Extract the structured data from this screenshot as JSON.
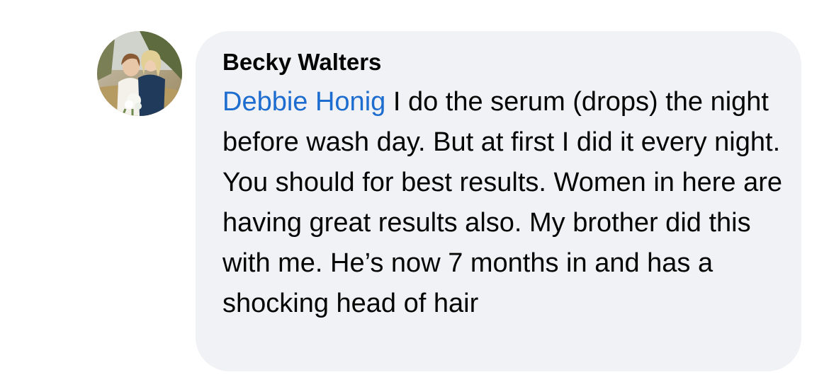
{
  "comment": {
    "avatar": "profile-photo",
    "author": "Becky Walters",
    "mention": "Debbie Honig",
    "text": " I do the serum (drops) the night before wash day. But at first I did it every night. You should for best results. Women in here are having great results also. My brother did this with me. He’s now 7 months in and has a shocking head of hair",
    "colors": {
      "bubble": "#f0f2f5",
      "mention": "#1d6ccf",
      "text": "#050505"
    }
  }
}
